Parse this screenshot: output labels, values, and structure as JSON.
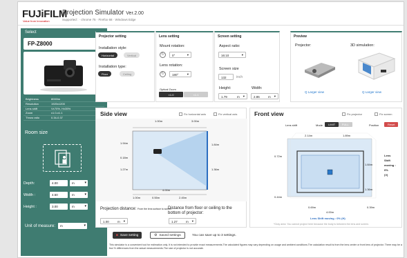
{
  "header": {
    "logo": "FUJiFILM",
    "tagline": "Value from Innovation",
    "title": "Projection Simulator",
    "version": "Ver.2.00",
    "supported": "Supported : · chrome 75 · Firefox 68 · Windows Edge"
  },
  "sidebar": {
    "select_label": "Select",
    "model": "FP-Z8000",
    "specs": [
      {
        "k": "Brightness",
        "v": "8000lm"
      },
      {
        "k": "Resolution",
        "v": "1920x1200"
      },
      {
        "k": "Lens shift",
        "v": "V±70%, H±35%"
      },
      {
        "k": "Zoom",
        "v": "x1.0-x1.1"
      },
      {
        "k": "Throw ratio",
        "v": "0.34-0.37"
      }
    ],
    "room_size": "Room size",
    "depth_label": "Depth:",
    "depth_val": "4.00",
    "width_label": "Width :",
    "width_val": "4.50",
    "height_label": "Height :",
    "height_val": "3.00",
    "unit": "m",
    "unit_label": "Unit of measure:"
  },
  "projector_setting": {
    "title": "Projector setting",
    "style_label": "Installation style:",
    "horizontal": "Horizontal",
    "vertical": "Vertical",
    "type_label": "Installation type:",
    "floor": "Floor",
    "ceiling": "Ceiling"
  },
  "lens_setting": {
    "title": "Lens setting",
    "mount_label": "Mount rotation:",
    "mount_val": "0°",
    "lens_rot_label": "Lens rotation:",
    "lens_rot_val": "180°",
    "zoom_label": "Optical Zoom",
    "zoom_a": "×1.0",
    "zoom_b": "×1.1"
  },
  "screen_setting": {
    "title": "Screen setting",
    "aspect_label": "Aspect ratio:",
    "aspect_val": "16:10",
    "size_label": "Screen size",
    "size_val": "132",
    "size_unit": "inch",
    "height_label": "Height:",
    "height_val": "1.79",
    "width_label": "Width:",
    "width_val": "2.86",
    "unit": "m"
  },
  "preview": {
    "title": "Preview",
    "projector": "Projector:",
    "sim": "3D simulation:",
    "larger1": "Q Larger view",
    "larger2": "Q Larger view"
  },
  "side_view": {
    "title": "Side view",
    "fix_h": "Fix horizontal axis",
    "fix_v": "Fix vertical axis",
    "top_a": "1.00m",
    "top_b": "3.00m",
    "l1": "1.94m",
    "l2": "0.18m",
    "l3": "1.27m",
    "r1": "1.84m",
    "r2": "1.36m",
    "b_mid": "4.00m",
    "b1": "1.00m",
    "b2": "0.55m",
    "b3": "2.45m",
    "pd_label": "Projection distance:",
    "pd_small": "From the lens surface to screen",
    "pd_val": "1.00",
    "fc_label": "Distance from floor or ceiling to the bottom of projector:",
    "fc_val": "1.27"
  },
  "front_view": {
    "title": "Front view",
    "fix_p": "Fix projector",
    "fix_s": "Fix screen",
    "lens_shift": "Lens shift",
    "mode": "Mode",
    "limit": "LIMIT",
    "full": "FULL",
    "position": "Position",
    "reset": "Reset",
    "t1": "2.14m",
    "t2": "1.89m",
    "l1": "0.72m",
    "r1": "1.84m",
    "r2": "1.36m",
    "l2": "0.44m",
    "b1": "0.69m",
    "b2": "4.00m",
    "b3": "0.39m",
    "moving": "Lens Shift moving : 0% (H)",
    "info_a": "Lens",
    "info_b": "Shift",
    "info_c": "moving :",
    "info_d": "0%",
    "info_e": "(V)",
    "note": "*Gray area: You cannot project here because the body is between the lens and screen."
  },
  "save": {
    "save_btn": "Save setting",
    "saved_btn": "Saved settings",
    "note": "You can save up to 3 settings."
  },
  "footer": "This simulator is a convenient tool for estimation only. It is not intended to provide exact measurements.The calculated figures may vary depending on usage and ambient conditions.The calculation result is from the lens center or front lens of projector. There may be a few % differences from the actual measurements.The size of projector is not accurate."
}
